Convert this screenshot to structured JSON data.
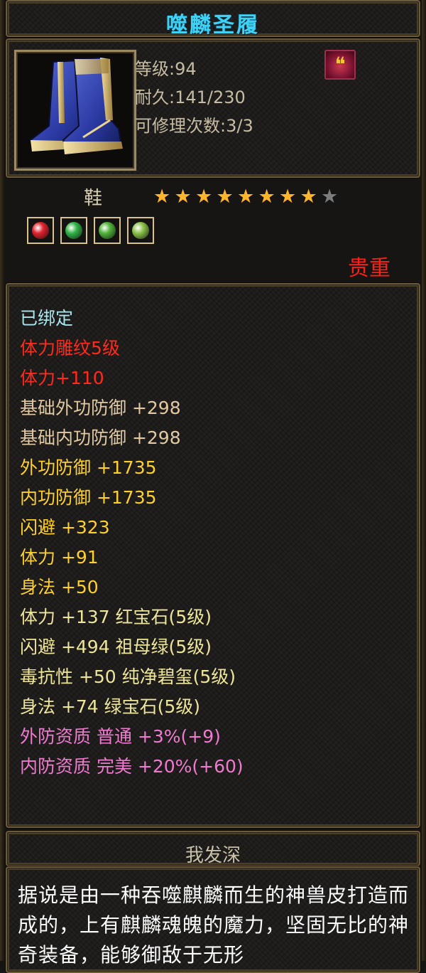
{
  "item": {
    "name": "噬麟圣履",
    "level_label": "等级:94",
    "durability_label": "耐久:141/230",
    "repair_label": "可修理次数:3/3",
    "durability": {
      "current": 141,
      "max": 230
    },
    "repairs": {
      "current": 3,
      "max": 3
    },
    "type": "鞋",
    "stars": {
      "filled": 8,
      "total": 9
    },
    "rarity": "贵重",
    "badge_icon": "phoenix-feather-icon",
    "thumbnail_icon": "blue-gold-boots-icon"
  },
  "gems": [
    {
      "icon": "ruby-gem-icon",
      "color": "#e0222e"
    },
    {
      "icon": "emerald-gem-icon",
      "color": "#33b548"
    },
    {
      "icon": "jade-gem-icon",
      "color": "#51b53a"
    },
    {
      "icon": "green-gem-icon",
      "color": "#8bc24a"
    }
  ],
  "attributes": [
    {
      "text": "已绑定",
      "color": "#a9e6ee"
    },
    {
      "text": "体力雕纹5级",
      "color": "#ff2a1c"
    },
    {
      "text": "体力+110",
      "color": "#ff2a1c"
    },
    {
      "text": "基础外功防御 +298",
      "color": "#e2c9a1"
    },
    {
      "text": "基础内功防御 +298",
      "color": "#e2c9a1"
    },
    {
      "text": "外功防御 +1735",
      "color": "#ffd02c"
    },
    {
      "text": "内功防御 +1735",
      "color": "#ffd02c"
    },
    {
      "text": "闪避 +323",
      "color": "#ffd02c"
    },
    {
      "text": "体力 +91",
      "color": "#ffd02c"
    },
    {
      "text": "身法 +50",
      "color": "#ffd02c"
    },
    {
      "text": "体力 +137 红宝石(5级)",
      "color": "#ede59a"
    },
    {
      "text": "闪避 +494 祖母绿(5级)",
      "color": "#ede59a"
    },
    {
      "text": "毒抗性 +50 纯净碧玺(5级)",
      "color": "#ede59a"
    },
    {
      "text": "身法 +74 绿宝石(5级)",
      "color": "#ede59a"
    },
    {
      "text": "外防资质  普通 +3%(+9)",
      "color": "#f07ad0"
    },
    {
      "text": "内防资质  完美 +20%(+60)",
      "color": "#f07ad0"
    }
  ],
  "description": {
    "heading": "我发深",
    "text": "据说是由一种吞噬麒麟而生的神兽皮打造而成的，上有麒麟魂魄的魔力，坚固无比的神奇装备，能够御敌于无形"
  },
  "colors": {
    "title": "#3fd2f5",
    "frame": "#6b5b3a",
    "star_filled": "#ffb52a",
    "star_empty": "#7d7d7d"
  }
}
